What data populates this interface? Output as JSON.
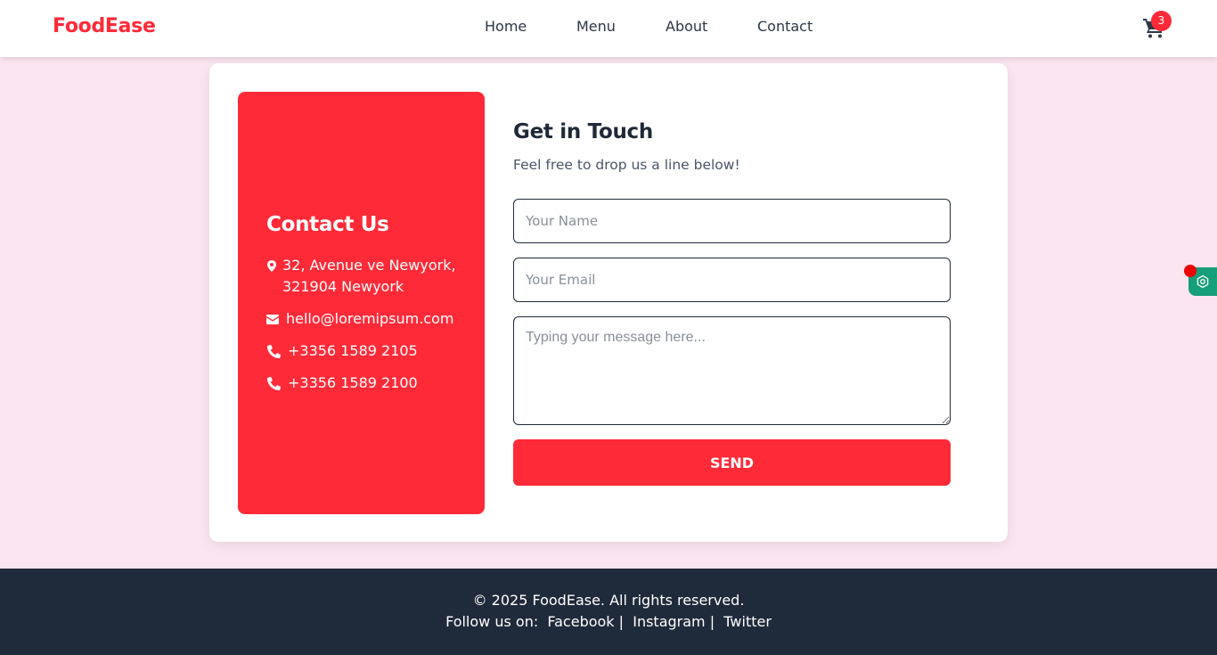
{
  "brand": {
    "name": "FoodEase",
    "color": "#ff2a38"
  },
  "nav": {
    "links": [
      {
        "label": "Home"
      },
      {
        "label": "Menu"
      },
      {
        "label": "About"
      },
      {
        "label": "Contact"
      }
    ],
    "cart": {
      "icon": "cart-icon",
      "count": "3"
    }
  },
  "contact_info": {
    "title": "Contact Us",
    "address_line1": "32, Avenue ve Newyork,",
    "address_line2": "321904 Newyork",
    "email": "hello@loremipsum.com",
    "phone1": "+3356 1589 2105",
    "phone2": "+3356 1589 2100",
    "icons": [
      "map-pin-icon",
      "envelope-icon",
      "phone-icon",
      "phone-icon"
    ]
  },
  "form": {
    "title": "Get in Touch",
    "subtitle": "Feel free to drop us a line below!",
    "name_placeholder": "Your Name",
    "email_placeholder": "Your Email",
    "message_placeholder": "Typing your message here...",
    "name_value": "",
    "email_value": "",
    "message_value": "",
    "send_label": "SEND"
  },
  "footer": {
    "copyright": "© 2025 FoodEase. All rights reserved.",
    "follow_label": "Follow us on:",
    "facebook": "Facebook",
    "instagram": "Instagram",
    "twitter": "Twitter",
    "separator": "|"
  },
  "widget": {
    "icon": "settings-hex-icon",
    "color": "#179e7a"
  },
  "colors": {
    "accent": "#ff2a38",
    "page_bg": "#fbe5f0",
    "footer_bg": "#1f2a3a"
  }
}
